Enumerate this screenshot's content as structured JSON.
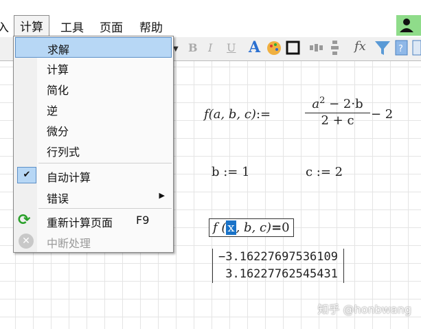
{
  "menubar": {
    "partial": "入",
    "items": [
      "计算",
      "工具",
      "页面",
      "帮助"
    ]
  },
  "toolbar": {
    "bold": "B",
    "italic": "I",
    "underline": "U",
    "font_color": "A",
    "function": "fx"
  },
  "menu": {
    "items": [
      {
        "label": "求解",
        "highlighted": true
      },
      {
        "label": "计算"
      },
      {
        "label": "简化"
      },
      {
        "label": "逆"
      },
      {
        "label": "微分"
      },
      {
        "label": "行列式"
      },
      {
        "label": "自动计算",
        "checked": true
      },
      {
        "label": "错误",
        "submenu": true
      },
      {
        "label": "重新计算页面",
        "shortcut": "F9",
        "icon": "refresh-icon"
      },
      {
        "label": "中断处理",
        "disabled": true,
        "icon": "stop-icon"
      }
    ]
  },
  "worksheet": {
    "def_lhs": "f",
    "def_args": "(a, b, c)",
    "assign": ":=",
    "num": "a² − 2·b",
    "num_base": "a",
    "num_exp": "2",
    "num_rest": " − 2·b",
    "den": "2 + c",
    "tail": " − 2",
    "b_def": "b := 1",
    "c_def": "c := 2",
    "solve_f": "f (",
    "solve_var": "x",
    "solve_rest": ", b, c)",
    "solve_eq": "=",
    "solve_rhs": "0",
    "results": [
      "−3.16227697536109",
      "3.16227762545431"
    ]
  },
  "watermark": "知乎 @honbwang",
  "colors": {
    "highlight": "#b7d7f5",
    "selection": "#1a73c8",
    "user": "#8fdc8a"
  }
}
